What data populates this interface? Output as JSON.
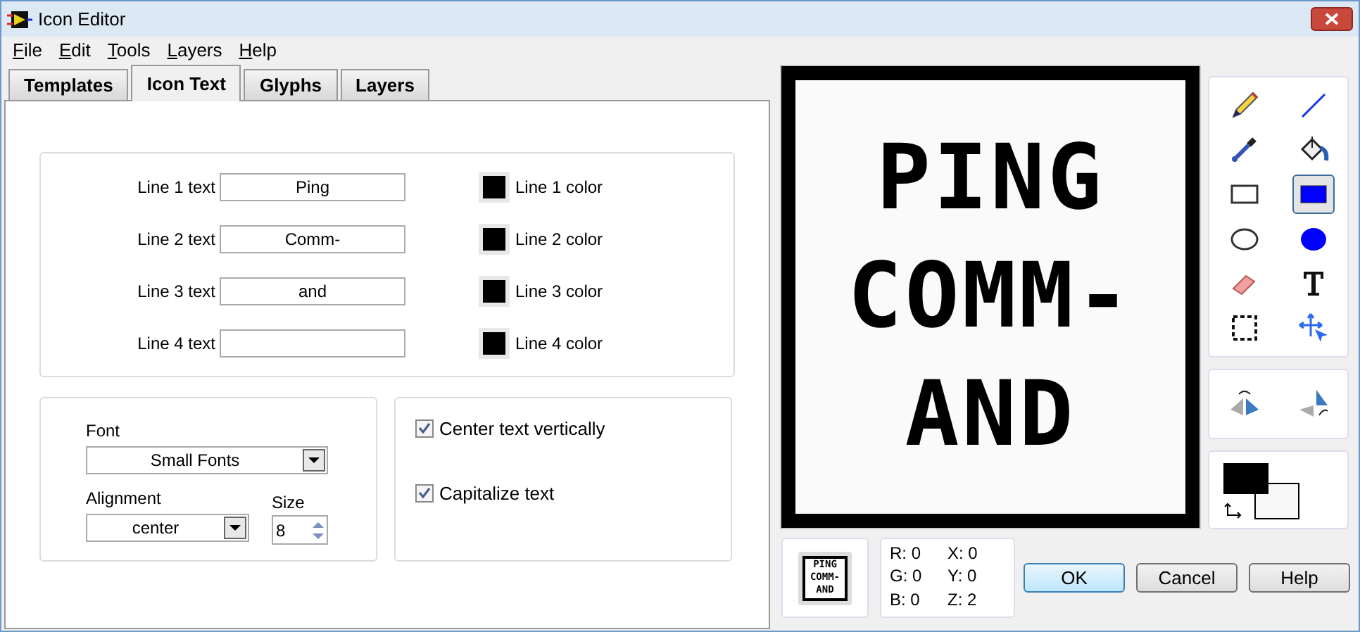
{
  "window": {
    "title": "Icon Editor"
  },
  "menu": [
    {
      "label": "File"
    },
    {
      "label": "Edit"
    },
    {
      "label": "Tools"
    },
    {
      "label": "Layers"
    },
    {
      "label": "Help"
    }
  ],
  "tabs": [
    {
      "label": "Templates",
      "selected": false
    },
    {
      "label": "Icon Text",
      "selected": true
    },
    {
      "label": "Glyphs",
      "selected": false
    },
    {
      "label": "Layers",
      "selected": false
    }
  ],
  "lines": [
    {
      "label": "Line 1 text",
      "value": "Ping",
      "color_label": "Line 1 color",
      "color": "#000000"
    },
    {
      "label": "Line 2 text",
      "value": "Comm-",
      "color_label": "Line 2 color",
      "color": "#000000"
    },
    {
      "label": "Line 3 text",
      "value": "and",
      "color_label": "Line 3 color",
      "color": "#000000"
    },
    {
      "label": "Line 4 text",
      "color_label": "Line 4 color",
      "color": "#000000"
    }
  ],
  "font": {
    "label": "Font",
    "value": "Small Fonts"
  },
  "alignment": {
    "label": "Alignment",
    "value": "center"
  },
  "size": {
    "label": "Size",
    "value": "8"
  },
  "options": [
    {
      "label": "Center text vertically",
      "checked": true
    },
    {
      "label": "Capitalize text",
      "checked": true
    }
  ],
  "canvas": {
    "lines": [
      "PING",
      "COMM-",
      "AND"
    ]
  },
  "preview": {
    "lines": [
      "PING",
      "COMM-",
      "AND"
    ]
  },
  "tools": [
    {
      "kind": "pencil",
      "selected": false
    },
    {
      "kind": "line",
      "selected": false
    },
    {
      "kind": "dropper",
      "selected": false
    },
    {
      "kind": "fill",
      "selected": false
    },
    {
      "kind": "rect",
      "selected": false
    },
    {
      "kind": "filled-rect",
      "selected": true
    },
    {
      "kind": "ellipse",
      "selected": false
    },
    {
      "kind": "filled-ellipse",
      "selected": false
    },
    {
      "kind": "eraser",
      "selected": false
    },
    {
      "kind": "text",
      "selected": false
    },
    {
      "kind": "select",
      "selected": false
    },
    {
      "kind": "move",
      "selected": false
    }
  ],
  "readout": [
    "R: 0",
    "X: 0",
    "G: 0",
    "Y: 0",
    "B: 0",
    "Z: 2"
  ],
  "buttons": [
    "OK",
    "Cancel",
    "Help"
  ]
}
